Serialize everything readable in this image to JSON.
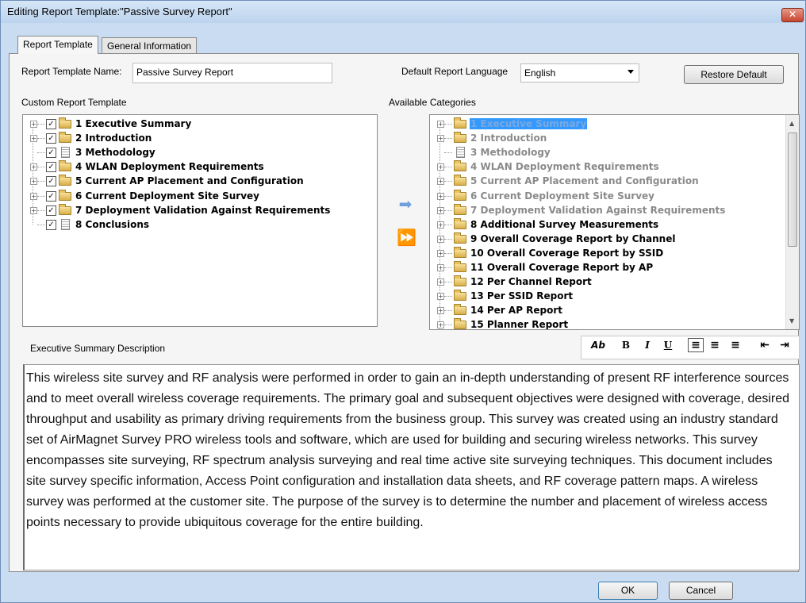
{
  "window": {
    "title": "Editing Report Template:\"Passive Survey Report\"",
    "close_glyph": "✕"
  },
  "tabs": [
    {
      "label": "Report Template",
      "active": true
    },
    {
      "label": "General Information",
      "active": false
    }
  ],
  "form": {
    "name_label": "Report Template Name:",
    "name_value": "Passive Survey Report",
    "language_label": "Default Report Language",
    "language_value": "English",
    "restore_label": "Restore Default"
  },
  "custom": {
    "label": "Custom Report Template",
    "items": [
      {
        "label": "1 Executive Summary",
        "type": "folder",
        "checked": true,
        "expandable": true
      },
      {
        "label": "2 Introduction",
        "type": "folder",
        "checked": true,
        "expandable": true
      },
      {
        "label": "3 Methodology",
        "type": "doc",
        "checked": true,
        "expandable": false
      },
      {
        "label": "4 WLAN Deployment Requirements",
        "type": "folder",
        "checked": true,
        "expandable": true
      },
      {
        "label": "5 Current AP Placement and Configuration",
        "type": "folder",
        "checked": true,
        "expandable": true
      },
      {
        "label": "6 Current Deployment Site Survey",
        "type": "folder",
        "checked": true,
        "expandable": true
      },
      {
        "label": "7 Deployment Validation Against Requirements",
        "type": "folder",
        "checked": true,
        "expandable": true
      },
      {
        "label": "8 Conclusions",
        "type": "doc",
        "checked": true,
        "expandable": false
      }
    ]
  },
  "available": {
    "label": "Available Categories",
    "items": [
      {
        "label": "1 Executive Summary",
        "type": "folder",
        "gray": true,
        "selected": true
      },
      {
        "label": "2 Introduction",
        "type": "folder",
        "gray": true
      },
      {
        "label": "3 Methodology",
        "type": "doc",
        "gray": true
      },
      {
        "label": "4 WLAN Deployment Requirements",
        "type": "folder",
        "gray": true
      },
      {
        "label": "5 Current AP Placement and Configuration",
        "type": "folder",
        "gray": true
      },
      {
        "label": "6 Current Deployment Site Survey",
        "type": "folder",
        "gray": true
      },
      {
        "label": "7 Deployment Validation Against Requirements",
        "type": "folder",
        "gray": true
      },
      {
        "label": "8 Additional Survey Measurements",
        "type": "folder",
        "gray": false
      },
      {
        "label": "9 Overall Coverage Report by Channel",
        "type": "folder",
        "gray": false
      },
      {
        "label": "10 Overall Coverage Report by SSID",
        "type": "folder",
        "gray": false
      },
      {
        "label": "11 Overall Coverage Report by AP",
        "type": "folder",
        "gray": false
      },
      {
        "label": "12 Per Channel Report",
        "type": "folder",
        "gray": false
      },
      {
        "label": "13 Per SSID Report",
        "type": "folder",
        "gray": false
      },
      {
        "label": "14 Per AP Report",
        "type": "folder",
        "gray": false
      },
      {
        "label": "15 Planner Report",
        "type": "folder",
        "gray": false
      }
    ]
  },
  "transfer": {
    "add_glyph": "➡",
    "add_all_glyph": "⏩"
  },
  "description": {
    "label": "Executive Summary Description",
    "text": "This wireless site survey and RF analysis were performed in order to gain an in-depth understanding of present RF interference sources and to meet overall wireless coverage requirements. The primary goal and subsequent objectives were designed with coverage, desired throughput and usability as primary driving requirements from the business group. This survey was created using an industry standard set of AirMagnet Survey PRO wireless tools and software, which are used for building and securing wireless networks.  This survey encompasses site surveying, RF spectrum analysis surveying and real time active site surveying techniques. This document includes site survey specific information, Access Point configuration and installation data sheets, and RF coverage pattern maps. A wireless survey was performed at the customer site.  The purpose of the survey is to determine the number and placement of wireless access points necessary to provide ubiquitous coverage for the entire building."
  },
  "toolbar": {
    "font": "Ab",
    "bold": "B",
    "italic": "I",
    "underline": "U",
    "align_left": "≡",
    "align_center": "≡",
    "align_right": "≡",
    "outdent": "⇤",
    "indent": "⇥"
  },
  "buttons": {
    "ok": "OK",
    "cancel": "Cancel"
  }
}
